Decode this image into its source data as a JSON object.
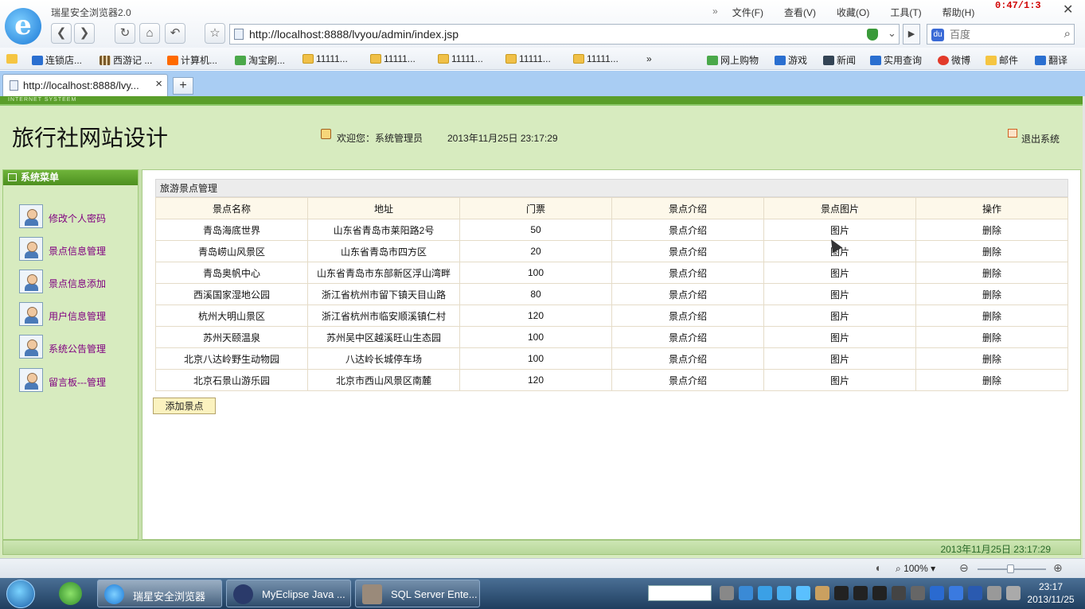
{
  "browser": {
    "app_title": "瑞星安全浏览器2.0",
    "menus": [
      "文件(F)",
      "查看(V)",
      "收藏(O)",
      "工具(T)",
      "帮助(H)"
    ],
    "menu_more": "»",
    "timer": "0:47/1:3",
    "url": "http://localhost:8888/lvyou/admin/index.jsp",
    "search_placeholder": "百度",
    "favorites": [
      "连锁店...",
      "西游记 ...",
      "计算机...",
      "淘宝刷...",
      "11111...",
      "11111...",
      "11111...",
      "11111...",
      "11111..."
    ],
    "favorites_more": "»",
    "favorites_right": [
      "网上购物",
      "游戏",
      "新闻",
      "实用查询",
      "微博",
      "邮件",
      "翻译"
    ],
    "tab_label": "http://localhost:8888/lvy...",
    "tab_close": "×",
    "new_tab": "+",
    "zoom": "100%"
  },
  "site": {
    "stripe_text": "INTERNET SYSTEEM",
    "title": "旅行社网站设计",
    "welcome": "欢迎您：系统管理员",
    "datetime": "2013年11月25日  23:17:29",
    "logout": "退出系统",
    "footer_datetime": "2013年11月25日  23:17:29"
  },
  "sidebar": {
    "heading": "系统菜单",
    "items": [
      {
        "label": "修改个人密码"
      },
      {
        "label": "景点信息管理"
      },
      {
        "label": "景点信息添加"
      },
      {
        "label": "用户信息管理"
      },
      {
        "label": "系统公告管理"
      },
      {
        "label": "留言板---管理"
      }
    ]
  },
  "main": {
    "panel_title": "旅游景点管理",
    "columns": [
      "景点名称",
      "地址",
      "门票",
      "景点介绍",
      "景点图片",
      "操作"
    ],
    "rows": [
      {
        "name": "青岛海底世界",
        "address": "山东省青岛市莱阳路2号",
        "price": "50",
        "intro": "景点介绍",
        "image": "图片",
        "action": "删除"
      },
      {
        "name": "青岛崂山风景区",
        "address": "山东省青岛市四方区",
        "price": "20",
        "intro": "景点介绍",
        "image": "图片",
        "action": "删除"
      },
      {
        "name": "青岛奥帆中心",
        "address": "山东省青岛市东部新区浮山湾畔",
        "price": "100",
        "intro": "景点介绍",
        "image": "图片",
        "action": "删除"
      },
      {
        "name": "西溪国家湿地公园",
        "address": "浙江省杭州市留下镇天目山路",
        "price": "80",
        "intro": "景点介绍",
        "image": "图片",
        "action": "删除"
      },
      {
        "name": "杭州大明山景区",
        "address": "浙江省杭州市临安顺溪镇仁村",
        "price": "120",
        "intro": "景点介绍",
        "image": "图片",
        "action": "删除"
      },
      {
        "name": "苏州天颐温泉",
        "address": "苏州吴中区越溪旺山生态园",
        "price": "100",
        "intro": "景点介绍",
        "image": "图片",
        "action": "删除"
      },
      {
        "name": "北京八达岭野生动物园",
        "address": "八达岭长城停车场",
        "price": "100",
        "intro": "景点介绍",
        "image": "图片",
        "action": "删除"
      },
      {
        "name": "北京石景山游乐园",
        "address": "北京市西山风景区南麓",
        "price": "120",
        "intro": "景点介绍",
        "image": "图片",
        "action": "删除"
      }
    ],
    "add_button": "添加景点"
  },
  "taskbar": {
    "tasks": [
      "瑞星安全浏览器",
      "MyEclipse Java ...",
      "SQL Server Ente..."
    ],
    "time": "23:17",
    "date": "2013/11/25"
  }
}
